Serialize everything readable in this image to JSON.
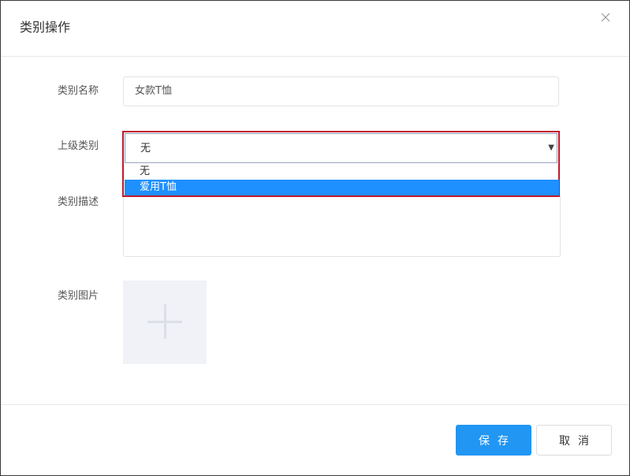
{
  "dialog": {
    "title": "类别操作"
  },
  "form": {
    "name": {
      "label": "类别名称",
      "value": "女款T恤"
    },
    "parent": {
      "label": "上级类别",
      "selected": "无",
      "options": [
        "无",
        "爱用T恤"
      ],
      "highlighted_option": "爱用T恤"
    },
    "description": {
      "label": "类别描述",
      "value": ""
    },
    "image": {
      "label": "类别图片"
    }
  },
  "footer": {
    "save_label": "保存",
    "cancel_label": "取消"
  },
  "icons": {
    "close": "close-icon",
    "upload": "plus-icon",
    "dropdown": "caret-down-icon"
  },
  "colors": {
    "primary": "#2196f3",
    "highlight_border": "#c0182c",
    "option_selected_bg": "#1e90ff"
  }
}
